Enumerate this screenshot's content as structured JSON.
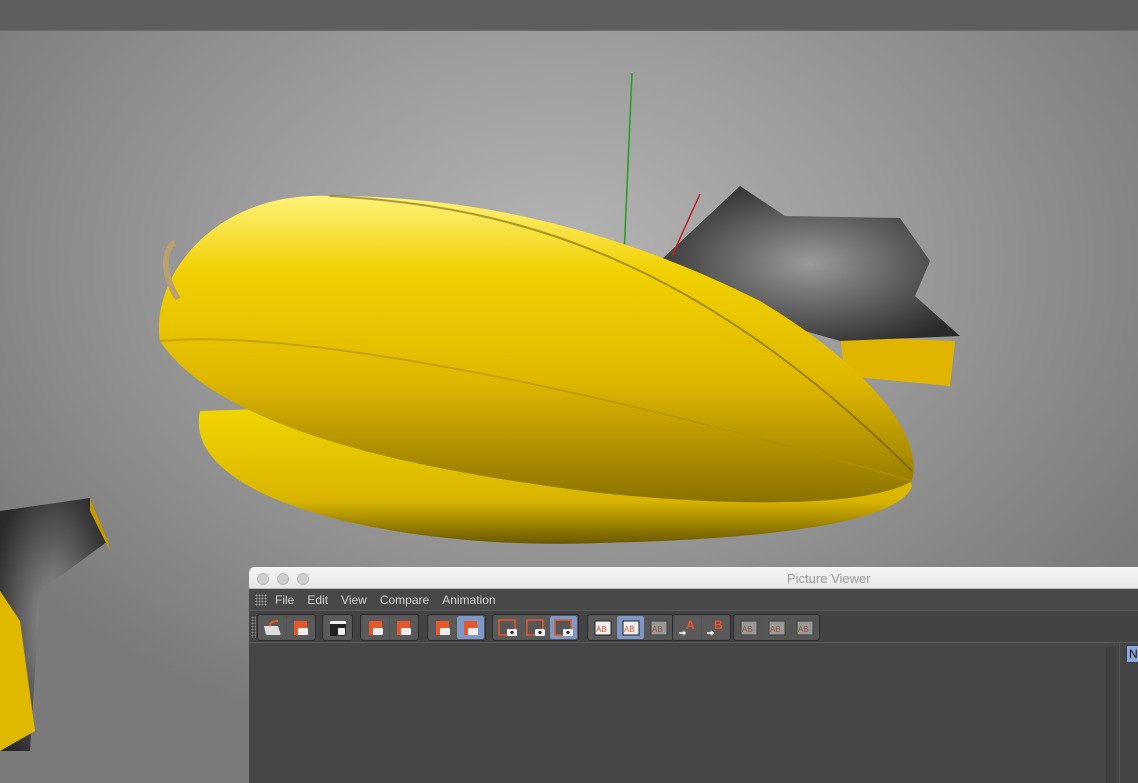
{
  "picture_viewer": {
    "title": "Picture Viewer",
    "menu": [
      "File",
      "Edit",
      "View",
      "Compare",
      "Animation"
    ],
    "toolbar_groups": [
      [
        {
          "icon": "open-folder-icon",
          "state": "normal"
        },
        {
          "icon": "save-as-icon",
          "state": "normal"
        }
      ],
      [
        {
          "icon": "render-clapper-icon",
          "state": "normal"
        }
      ],
      [
        {
          "icon": "import-sequence-icon",
          "state": "normal"
        },
        {
          "icon": "export-icon",
          "state": "normal"
        }
      ],
      [
        {
          "icon": "delete-icon",
          "state": "normal"
        },
        {
          "icon": "history-layers-icon",
          "state": "active"
        }
      ],
      [
        {
          "icon": "region-view-icon",
          "state": "normal"
        },
        {
          "icon": "region-view-alt-icon",
          "state": "normal"
        },
        {
          "icon": "channels-view-icon",
          "state": "active"
        }
      ],
      [
        {
          "icon": "ab-compare-icon",
          "state": "normal"
        },
        {
          "icon": "ab-split-icon",
          "state": "active"
        },
        {
          "icon": "ab-difference-icon",
          "state": "disabled"
        }
      ],
      [
        {
          "icon": "set-a-icon",
          "state": "normal",
          "label": "A"
        },
        {
          "icon": "set-b-icon",
          "state": "normal",
          "label": "B"
        }
      ],
      [
        {
          "icon": "ab-swap-icon",
          "state": "disabled"
        },
        {
          "icon": "ab-grid-icon",
          "state": "disabled"
        },
        {
          "icon": "ab-list-icon",
          "state": "disabled"
        }
      ]
    ],
    "side_tab_label": "N"
  },
  "colors": {
    "accent_orange": "#e8572a",
    "active_blue": "#7f97c4",
    "fruit_yellow": "#e8c800"
  }
}
